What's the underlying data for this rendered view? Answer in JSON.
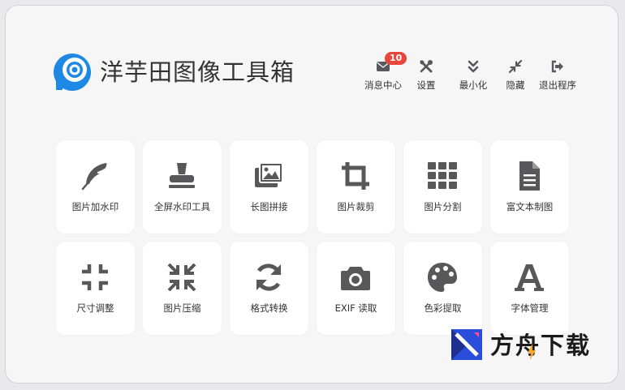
{
  "app": {
    "title": "洋芋田图像工具箱"
  },
  "toolbar": [
    {
      "label": "消息中心",
      "icon": "envelope-icon",
      "badge": "10"
    },
    {
      "label": "设置",
      "icon": "tools-icon"
    },
    {
      "label": "最小化",
      "icon": "chevron-double-down-icon"
    },
    {
      "label": "隐藏",
      "icon": "compress-arrows-icon"
    },
    {
      "label": "退出程序",
      "icon": "sign-out-icon"
    }
  ],
  "tools": [
    {
      "label": "图片加水印",
      "icon": "feather-icon"
    },
    {
      "label": "全屏水印工具",
      "icon": "stamp-icon"
    },
    {
      "label": "长图拼接",
      "icon": "images-icon"
    },
    {
      "label": "图片裁剪",
      "icon": "crop-icon"
    },
    {
      "label": "图片分割",
      "icon": "grid-icon"
    },
    {
      "label": "富文本制图",
      "icon": "document-icon"
    },
    {
      "label": "尺寸调整",
      "icon": "compress-icon"
    },
    {
      "label": "图片压缩",
      "icon": "compress-arrows-icon"
    },
    {
      "label": "格式转换",
      "icon": "sync-icon"
    },
    {
      "label": "EXIF 读取",
      "icon": "camera-icon"
    },
    {
      "label": "色彩提取",
      "icon": "palette-icon"
    },
    {
      "label": "字体管理",
      "icon": "font-icon"
    }
  ],
  "watermark": {
    "text": "方舟下载"
  },
  "colors": {
    "icon": "#58585a",
    "badge": "#e8453c",
    "brand_blue": "#1e88e5",
    "tile": "#ffffff"
  }
}
